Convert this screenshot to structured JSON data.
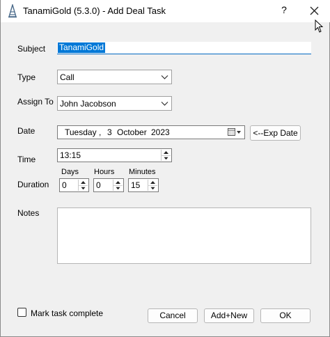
{
  "window": {
    "title": "TanamiGold (5.3.0) - Add Deal Task",
    "help_glyph": "?",
    "close_icon": "close-icon"
  },
  "form": {
    "subject_label": "Subject",
    "subject_value": "TanamiGold",
    "type_label": "Type",
    "type_value": "Call",
    "assign_label": "Assign To",
    "assign_value": "John Jacobson",
    "date_label": "Date",
    "date": {
      "weekday": "Tuesday",
      "sep": ",",
      "day": "3",
      "month": "October",
      "year": "2023"
    },
    "exp_date_button": "<--Exp Date",
    "time_label": "Time",
    "time_value": "13:15",
    "duration_label": "Duration",
    "days_label": "Days",
    "hours_label": "Hours",
    "minutes_label": "Minutes",
    "days_value": "0",
    "hours_value": "0",
    "minutes_value": "15",
    "notes_label": "Notes",
    "notes_value": "",
    "complete_label": "Mark task complete",
    "complete_checked": false
  },
  "buttons": {
    "cancel": "Cancel",
    "add_new": "Add+New",
    "ok": "OK"
  },
  "colors": {
    "selection": "#0078d7",
    "focus_underline": "#0067c0",
    "dialog_bg": "#f0f0f0"
  }
}
